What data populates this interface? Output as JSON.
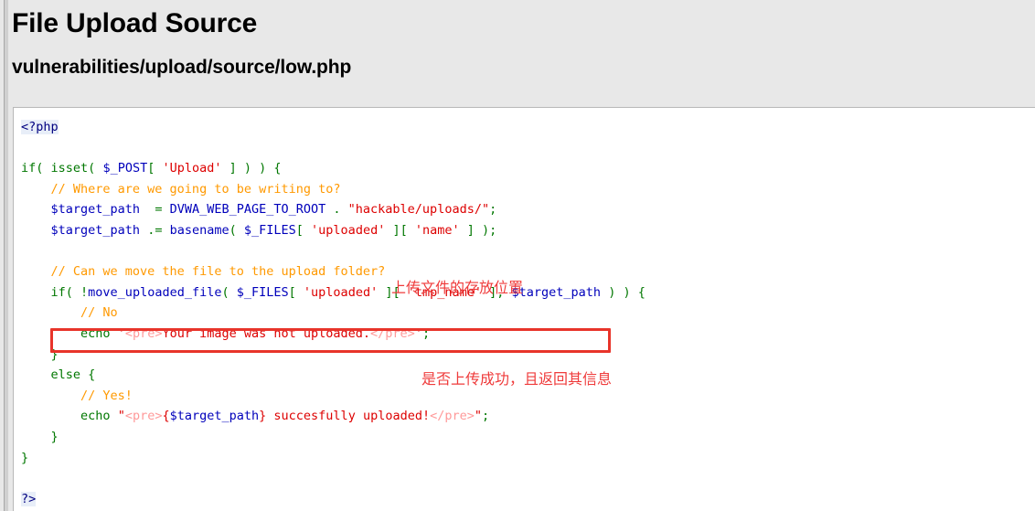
{
  "page": {
    "title": "File Upload Source",
    "source_path": "vulnerabilities/upload/source/low.php",
    "background_color": "#e8e8e8",
    "code_background_color": "#ffffff"
  },
  "colors": {
    "keyword": "#007700",
    "variable": "#0000bb",
    "string": "#dd0000",
    "string_tag": "#ff9999",
    "comment": "#ff9900",
    "php_delimiter": "#000080",
    "annotation_red": "#ef3b3b",
    "highlight_border": "#e8342a"
  },
  "code": {
    "language": "php",
    "lines": [
      {
        "n": 1,
        "tokens": [
          {
            "t": "<?php",
            "c": "open"
          }
        ]
      },
      {
        "n": 2,
        "tokens": []
      },
      {
        "n": 3,
        "tokens": [
          {
            "t": "if",
            "c": "kw"
          },
          {
            "t": "( ",
            "c": "kw"
          },
          {
            "t": "isset",
            "c": "kw"
          },
          {
            "t": "( ",
            "c": "kw"
          },
          {
            "t": "$_POST",
            "c": "var"
          },
          {
            "t": "[ ",
            "c": "kw"
          },
          {
            "t": "'Upload'",
            "c": "str"
          },
          {
            "t": " ] ) ) {",
            "c": "kw"
          }
        ]
      },
      {
        "n": 4,
        "tokens": [
          {
            "t": "    // Where are we going to be writing to?",
            "c": "cmt"
          }
        ]
      },
      {
        "n": 5,
        "tokens": [
          {
            "t": "    ",
            "c": "plain"
          },
          {
            "t": "$target_path",
            "c": "var"
          },
          {
            "t": "  = ",
            "c": "kw"
          },
          {
            "t": "DVWA_WEB_PAGE_TO_ROOT",
            "c": "var"
          },
          {
            "t": " . ",
            "c": "kw"
          },
          {
            "t": "\"hackable/uploads/\"",
            "c": "str"
          },
          {
            "t": ";",
            "c": "kw"
          }
        ]
      },
      {
        "n": 6,
        "tokens": [
          {
            "t": "    ",
            "c": "plain"
          },
          {
            "t": "$target_path",
            "c": "var"
          },
          {
            "t": " .= ",
            "c": "kw"
          },
          {
            "t": "basename",
            "c": "var"
          },
          {
            "t": "( ",
            "c": "kw"
          },
          {
            "t": "$_FILES",
            "c": "var"
          },
          {
            "t": "[ ",
            "c": "kw"
          },
          {
            "t": "'uploaded'",
            "c": "str"
          },
          {
            "t": " ][ ",
            "c": "kw"
          },
          {
            "t": "'name'",
            "c": "str"
          },
          {
            "t": " ] );",
            "c": "kw"
          }
        ]
      },
      {
        "n": 7,
        "tokens": []
      },
      {
        "n": 8,
        "tokens": [
          {
            "t": "    // Can we move the file to the upload folder?",
            "c": "cmt"
          }
        ]
      },
      {
        "n": 9,
        "tokens": [
          {
            "t": "    ",
            "c": "plain"
          },
          {
            "t": "if",
            "c": "kw"
          },
          {
            "t": "( !",
            "c": "kw"
          },
          {
            "t": "move_uploaded_file",
            "c": "var"
          },
          {
            "t": "( ",
            "c": "kw"
          },
          {
            "t": "$_FILES",
            "c": "var"
          },
          {
            "t": "[ ",
            "c": "kw"
          },
          {
            "t": "'uploaded'",
            "c": "str"
          },
          {
            "t": " ][ ",
            "c": "kw"
          },
          {
            "t": "'tmp_name'",
            "c": "str"
          },
          {
            "t": " ], ",
            "c": "kw"
          },
          {
            "t": "$target_path",
            "c": "var"
          },
          {
            "t": " ) ) {",
            "c": "kw"
          }
        ]
      },
      {
        "n": 10,
        "tokens": [
          {
            "t": "        // No",
            "c": "cmt"
          }
        ]
      },
      {
        "n": 11,
        "tokens": [
          {
            "t": "        ",
            "c": "plain"
          },
          {
            "t": "echo",
            "c": "kw"
          },
          {
            "t": " ",
            "c": "plain"
          },
          {
            "t": "'",
            "c": "str"
          },
          {
            "t": "<pre>",
            "c": "strtag"
          },
          {
            "t": "Your image was not uploaded.",
            "c": "str"
          },
          {
            "t": "</pre>",
            "c": "strtag"
          },
          {
            "t": "'",
            "c": "str"
          },
          {
            "t": ";",
            "c": "kw"
          }
        ]
      },
      {
        "n": 12,
        "tokens": [
          {
            "t": "    }",
            "c": "kw"
          }
        ]
      },
      {
        "n": 13,
        "tokens": [
          {
            "t": "    ",
            "c": "plain"
          },
          {
            "t": "else",
            "c": "kw"
          },
          {
            "t": " {",
            "c": "kw"
          }
        ]
      },
      {
        "n": 14,
        "tokens": [
          {
            "t": "        // Yes!",
            "c": "cmt"
          }
        ]
      },
      {
        "n": 15,
        "tokens": [
          {
            "t": "        ",
            "c": "plain"
          },
          {
            "t": "echo",
            "c": "kw"
          },
          {
            "t": " ",
            "c": "plain"
          },
          {
            "t": "\"",
            "c": "str"
          },
          {
            "t": "<pre>",
            "c": "strtag"
          },
          {
            "t": "{",
            "c": "str"
          },
          {
            "t": "$target_path",
            "c": "var"
          },
          {
            "t": "} succesfully uploaded!",
            "c": "str"
          },
          {
            "t": "</pre>",
            "c": "strtag"
          },
          {
            "t": "\"",
            "c": "str"
          },
          {
            "t": ";",
            "c": "kw"
          }
        ]
      },
      {
        "n": 16,
        "tokens": [
          {
            "t": "    }",
            "c": "kw"
          }
        ]
      },
      {
        "n": 17,
        "tokens": [
          {
            "t": "}",
            "c": "kw"
          }
        ]
      },
      {
        "n": 18,
        "tokens": []
      },
      {
        "n": 19,
        "tokens": [
          {
            "t": "?>",
            "c": "open"
          }
        ]
      }
    ]
  },
  "annotations": [
    {
      "id": "annot-1",
      "text": "上传文件的存放位置",
      "color": "#ef3b3b"
    },
    {
      "id": "annot-2",
      "text": "是否上传成功，且返回其信息",
      "color": "#ef3b3b"
    }
  ],
  "highlight": {
    "label": "red-box-around-target-path-concat-line",
    "target_line": 6,
    "color": "#e8342a"
  }
}
